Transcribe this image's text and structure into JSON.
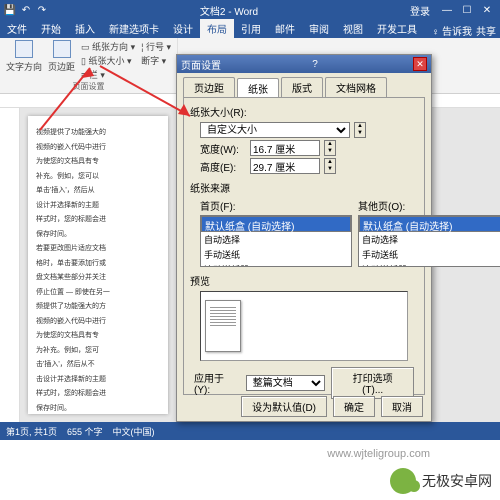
{
  "titlebar": {
    "title": "文档2 - Word",
    "login": "登录"
  },
  "tabs": {
    "t0": "文件",
    "t1": "开始",
    "t2": "插入",
    "t3": "新建选项卡",
    "t4": "设计",
    "t5": "布局",
    "t6": "引用",
    "t7": "邮件",
    "t8": "审阅",
    "t9": "视图",
    "t10": "开发工具",
    "search": "告诉我",
    "share": "共享"
  },
  "ribbon": {
    "g1a": "文字方向",
    "g1b": "页边距",
    "g1c": "纸张方向",
    "g1d": "纸张大小",
    "g1e": "栏",
    "g1f": "行号",
    "g1g": "断字",
    "group1": "页面设置"
  },
  "doc": {
    "p1": "视频提供了功能强大的",
    "p2": "视频的嵌入代码中进行",
    "p3": "为使您的文档具有专",
    "p4": "补充。例如，您可以",
    "p5": "单击'插入'，然后从",
    "p6": "设计并选择新的主题",
    "p7": "样式时，您的标题会进",
    "p8": "保存时间。",
    "p9": "若要更改图片适应文档",
    "p10": "格时，单击要添加行或",
    "p11": "盘文档某些部分并关注",
    "p12": "停止位置 — 即使在另一",
    "p13": "频提供了功能强大的方",
    "p14": "视频的嵌入代码中进行",
    "p15": "为使您的文档具有专",
    "p16": "为补充。例如，您可",
    "p17": "击'插入'，然后从不",
    "p18": "击设计并选择新的主题",
    "p19": "样式时，您的标题会进",
    "p20": "保存时间。"
  },
  "dialog": {
    "title": "页面设置",
    "tab1": "页边距",
    "tab2": "纸张",
    "tab3": "版式",
    "tab4": "文档网格",
    "papersize_lbl": "纸张大小(R):",
    "papersize_val": "自定义大小",
    "width_lbl": "宽度(W):",
    "width_val": "16.7 厘米",
    "height_lbl": "高度(E):",
    "height_val": "29.7 厘米",
    "source_lbl": "纸张来源",
    "first_lbl": "首页(F):",
    "other_lbl": "其他页(O):",
    "opt1": "默认纸盒 (自动选择)",
    "opt2": "自动选择",
    "opt3": "手动送纸",
    "opt4": "滚动送纸器",
    "preview_lbl": "预览",
    "applyto_lbl": "应用于(Y):",
    "applyto_val": "整篇文档",
    "printopt": "打印选项(T)...",
    "setdefault": "设为默认值(D)",
    "ok": "确定",
    "cancel": "取消"
  },
  "status": {
    "page": "第1页, 共1页",
    "words": "655 个字",
    "lang": "中文(中国)"
  },
  "watermark": {
    "text": "无极安卓网",
    "url": "www.wjteligroup.com"
  }
}
